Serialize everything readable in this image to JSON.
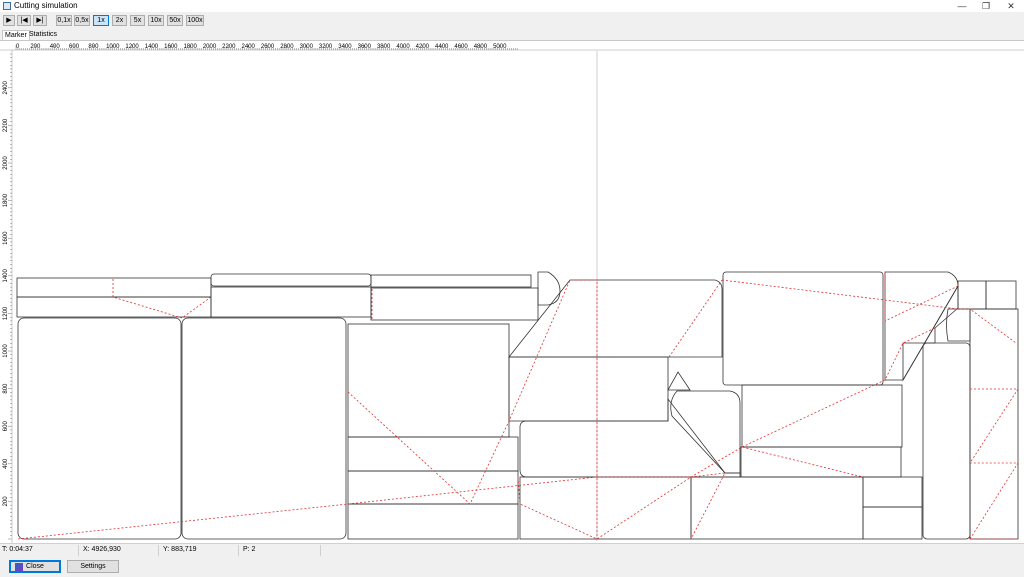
{
  "window": {
    "title": "Cutting simulation",
    "minimize": "—",
    "restore": "❐",
    "close": "✕"
  },
  "toolbar": {
    "play": "▶",
    "step_back": "|◀",
    "step_forward": "▶|",
    "speeds": [
      "0,1x",
      "0,5x",
      "1x",
      "2x",
      "5x",
      "10x",
      "50x",
      "100x"
    ],
    "active_speed": "1x"
  },
  "tabs": [
    "Marker",
    "Statistics"
  ],
  "ruler": {
    "x_labels": [
      "0",
      "200",
      "400",
      "600",
      "800",
      "1000",
      "1200",
      "1400",
      "1600",
      "1800",
      "2000",
      "2200",
      "2400",
      "2600",
      "2800",
      "3000",
      "3200",
      "3400",
      "3600",
      "3800",
      "4000",
      "4200",
      "4400",
      "4600",
      "4800",
      "5000"
    ],
    "y_labels": [
      "200",
      "400",
      "600",
      "800",
      "1000",
      "1200",
      "1400",
      "1600",
      "1800",
      "2000",
      "2200",
      "2400"
    ]
  },
  "status": {
    "time": "T: 0:04:37",
    "x": "X: 4926,930",
    "y": "Y: 883,719",
    "p": "P: 2"
  },
  "buttons": {
    "close": "Close",
    "settings": "Settings"
  },
  "colors": {
    "cut_line": "#333333",
    "path_line": "#e03030",
    "cursor_line": "#c8c8c8"
  }
}
